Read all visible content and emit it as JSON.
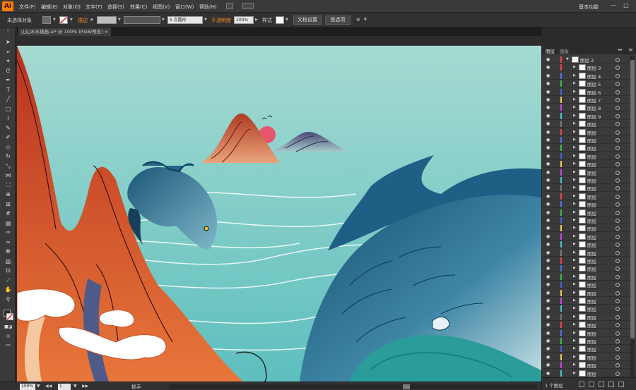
{
  "app": {
    "logo": "Ai",
    "menus": [
      "文件(F)",
      "编辑(E)",
      "对象(O)",
      "文字(T)",
      "选择(S)",
      "效果(C)",
      "视图(V)",
      "窗口(W)",
      "帮助(H)"
    ],
    "workspace": "基本功能",
    "window_buttons": [
      "—",
      "□"
    ]
  },
  "control_bar": {
    "selection": "未选择对象",
    "stroke_label": "描边",
    "brush_value": "5 点圆形",
    "opacity_label": "不透明度",
    "opacity_value": "100%",
    "style_label": "样式",
    "doc_setup_button": "文档设置",
    "preferences_button": "首选项"
  },
  "document": {
    "tab_title": "山山水水插画.ai* @ 100% (RGB/预览)"
  },
  "tools": [
    "selection-icon",
    "direct-selection-icon",
    "magic-wand-icon",
    "lasso-icon",
    "pen-icon",
    "type-icon",
    "line-icon",
    "rectangle-icon",
    "paintbrush-icon",
    "pencil-icon",
    "blob-brush-icon",
    "eraser-icon",
    "rotate-icon",
    "scale-icon",
    "width-icon",
    "free-transform-icon",
    "shape-builder-icon",
    "perspective-icon",
    "mesh-icon",
    "gradient-icon",
    "eyedropper-icon",
    "blend-icon",
    "symbol-sprayer-icon",
    "graph-icon",
    "artboard-icon",
    "slice-icon",
    "hand-icon",
    "zoom-icon"
  ],
  "status_bar": {
    "zoom": "100%",
    "artboard": "1",
    "tool": "抓手"
  },
  "layers_panel": {
    "tabs": [
      "图层",
      "画板"
    ],
    "parent_layer": "图层 2",
    "layers": [
      {
        "name": "图层 3",
        "color": "#e34b4b"
      },
      {
        "name": "图层 4",
        "color": "#4a78e0"
      },
      {
        "name": "图层 5",
        "color": "#49b84a"
      },
      {
        "name": "图层 6",
        "color": "#4a5ee0"
      },
      {
        "name": "图层 7",
        "color": "#e3d24a"
      },
      {
        "name": "图层 8",
        "color": "#c94ae0"
      },
      {
        "name": "图层 9",
        "color": "#4ac9c9"
      },
      {
        "name": "图层",
        "color": "#7a7a7a"
      },
      {
        "name": "图层",
        "color": "#e34b4b"
      },
      {
        "name": "图层",
        "color": "#4a78e0"
      },
      {
        "name": "图层",
        "color": "#49b84a"
      },
      {
        "name": "图层",
        "color": "#4a5ee0"
      },
      {
        "name": "图层",
        "color": "#e3d24a"
      },
      {
        "name": "图层",
        "color": "#c94ae0"
      },
      {
        "name": "图层",
        "color": "#4ac9c9"
      },
      {
        "name": "图层",
        "color": "#7a7a7a"
      },
      {
        "name": "图层",
        "color": "#e34b4b"
      },
      {
        "name": "图层",
        "color": "#4a78e0"
      },
      {
        "name": "图层",
        "color": "#49b84a"
      },
      {
        "name": "图层",
        "color": "#4a5ee0"
      },
      {
        "name": "图层",
        "color": "#e3d24a"
      },
      {
        "name": "图层",
        "color": "#c94ae0"
      },
      {
        "name": "图层",
        "color": "#4ac9c9"
      },
      {
        "name": "图层",
        "color": "#7a7a7a"
      },
      {
        "name": "图层",
        "color": "#e34b4b"
      },
      {
        "name": "图层",
        "color": "#4a78e0"
      },
      {
        "name": "图层",
        "color": "#49b84a"
      },
      {
        "name": "图层",
        "color": "#4a5ee0"
      },
      {
        "name": "图层",
        "color": "#e3d24a"
      },
      {
        "name": "图层",
        "color": "#c94ae0"
      },
      {
        "name": "图层",
        "color": "#4ac9c9"
      },
      {
        "name": "图层",
        "color": "#7a7a7a"
      },
      {
        "name": "图层",
        "color": "#e34b4b"
      },
      {
        "name": "图层",
        "color": "#4a78e0"
      },
      {
        "name": "图层",
        "color": "#49b84a"
      },
      {
        "name": "图层",
        "color": "#4a5ee0"
      },
      {
        "name": "图层",
        "color": "#e3d24a"
      },
      {
        "name": "图层",
        "color": "#c94ae0"
      },
      {
        "name": "图层",
        "color": "#4ac9c9"
      },
      {
        "name": "图层",
        "color": "#7a7a7a"
      }
    ],
    "footer_count": "1 个图层"
  },
  "colors": {
    "accent": "#ff8a1e",
    "canvas_sea": "#9fd6cf",
    "mountain_red": "#c4452a",
    "fish_blue": "#1f5f86"
  }
}
